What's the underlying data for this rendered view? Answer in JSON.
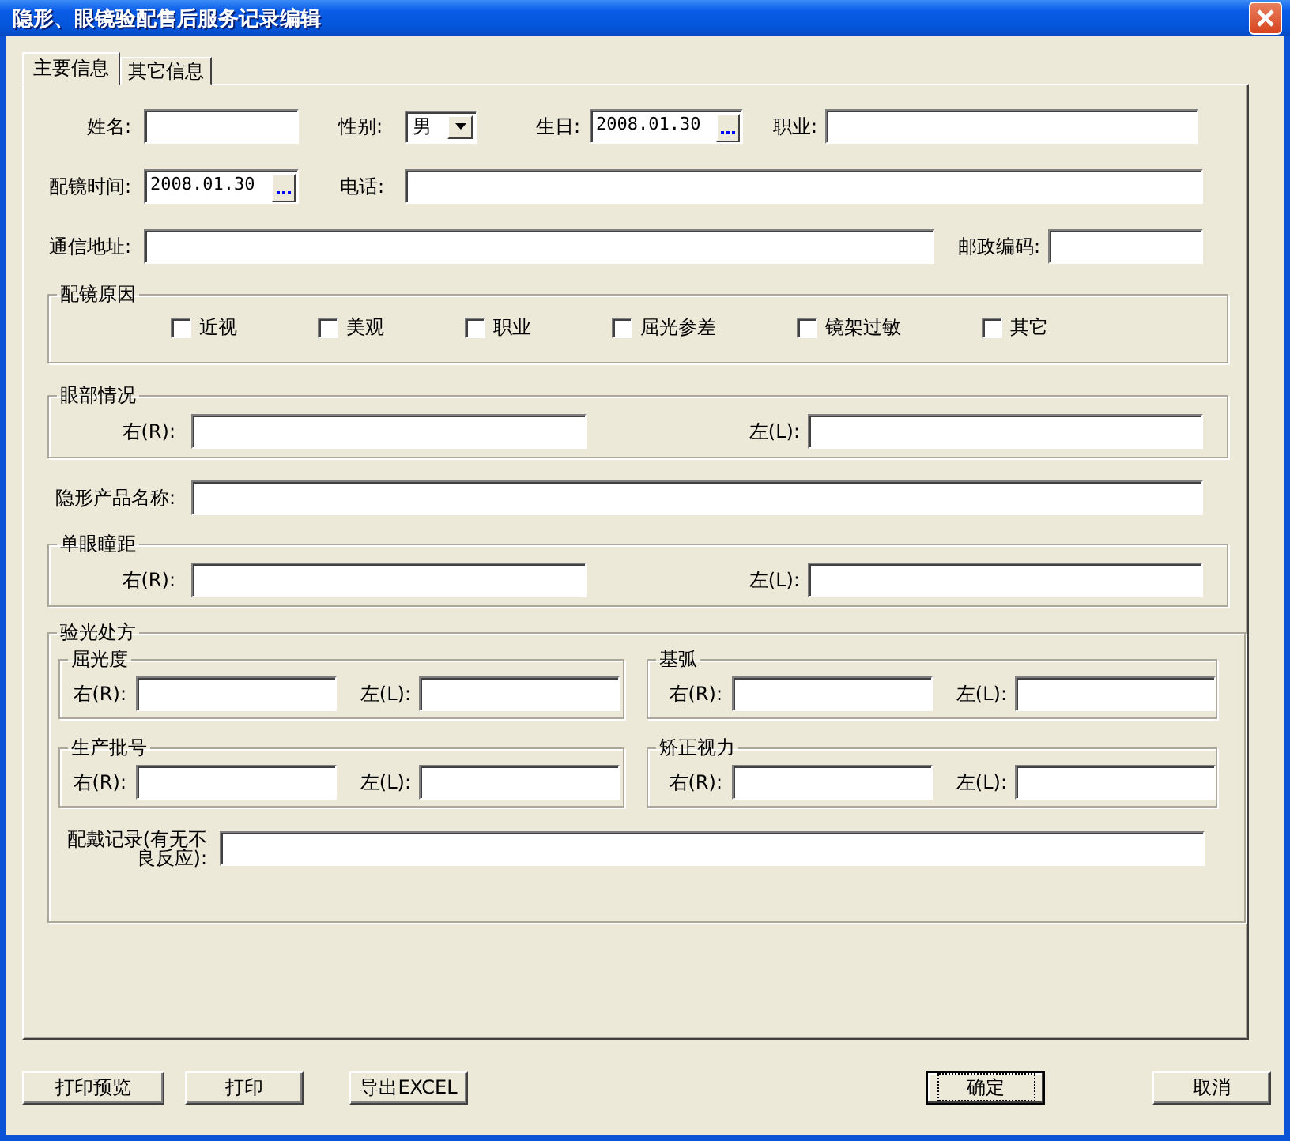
{
  "window": {
    "title": "隐形、眼镜验配售后服务记录编辑"
  },
  "tabs": [
    {
      "label": "主要信息",
      "selected": true
    },
    {
      "label": "其它信息",
      "selected": false
    }
  ],
  "personal": {
    "name": {
      "label": "姓名:"
    },
    "gender": {
      "label": "性别:",
      "value": "男"
    },
    "birthday": {
      "label": "生日:",
      "value": "2008.01.30"
    },
    "occupation": {
      "label": "职业:"
    },
    "fitting_time": {
      "label": "配镜时间:",
      "value": "2008.01.30"
    },
    "phone": {
      "label": "电话:"
    },
    "address": {
      "label": "通信地址:"
    },
    "postcode": {
      "label": "邮政编码:"
    }
  },
  "fit_reasons": {
    "title": "配镜原因",
    "options": [
      {
        "label": "近视",
        "checked": false
      },
      {
        "label": "美观",
        "checked": false
      },
      {
        "label": "职业",
        "checked": false
      },
      {
        "label": "屈光参差",
        "checked": false
      },
      {
        "label": "镜架过敏",
        "checked": false
      },
      {
        "label": "其它",
        "checked": false
      }
    ]
  },
  "eye_condition": {
    "title": "眼部情况",
    "right_label": "右(R):",
    "left_label": "左(L):"
  },
  "product_name": {
    "label": "隐形产品名称:"
  },
  "pupil_distance": {
    "title": "单眼瞳距",
    "right_label": "右(R):",
    "left_label": "左(L):"
  },
  "prescription": {
    "title": "验光处方",
    "groups": [
      {
        "title": "屈光度",
        "right_label": "右(R):",
        "left_label": "左(L):"
      },
      {
        "title": "基弧",
        "right_label": "右(R):",
        "left_label": "左(L):"
      },
      {
        "title": "生产批号",
        "right_label": "右(R):",
        "left_label": "左(L):"
      },
      {
        "title": "矫正视力",
        "right_label": "右(R):",
        "left_label": "左(L):"
      }
    ],
    "wear_record": {
      "label": "配戴记录(有无不良反应):"
    }
  },
  "buttons": [
    {
      "label": "打印预览",
      "default": false
    },
    {
      "label": "打印",
      "default": false
    },
    {
      "label": "导出EXCEL",
      "default": false
    },
    {
      "label": "确定",
      "default": true
    },
    {
      "label": "取消",
      "default": false
    }
  ]
}
